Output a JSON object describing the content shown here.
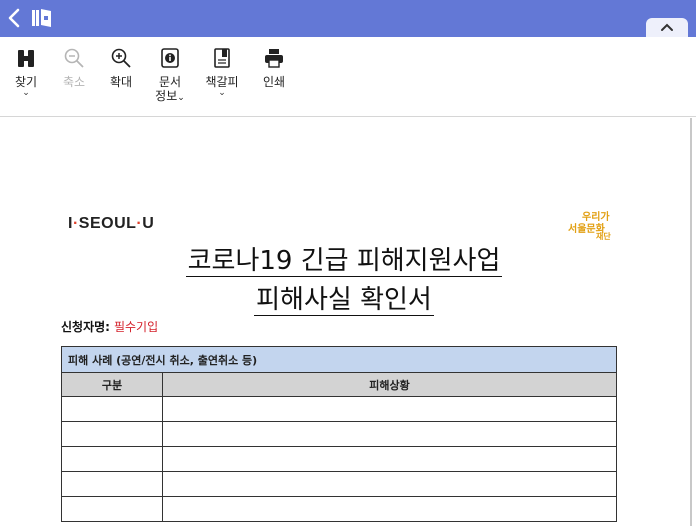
{
  "toolbar": {
    "items": [
      {
        "label": "찾기",
        "icon": "binoculars-icon",
        "has_dropdown": true,
        "enabled": true
      },
      {
        "label": "축소",
        "icon": "zoom-out-icon",
        "has_dropdown": false,
        "enabled": false
      },
      {
        "label": "확대",
        "icon": "zoom-in-icon",
        "has_dropdown": false,
        "enabled": true
      },
      {
        "label": "문서",
        "label2": "정보",
        "icon": "info-icon",
        "has_dropdown": true,
        "enabled": true
      },
      {
        "label": "책갈피",
        "icon": "bookmark-icon",
        "has_dropdown": true,
        "enabled": true
      },
      {
        "label": "인쇄",
        "icon": "printer-icon",
        "has_dropdown": false,
        "enabled": true
      }
    ],
    "chevron": "⌄"
  },
  "colors": {
    "topbar": "#6378d6",
    "section_header": "#c3d5ee",
    "column_header": "#d3d3d3",
    "required_text": "#d4202a",
    "seal": "#e2a013"
  },
  "document": {
    "logo": {
      "part1": "I",
      "dot": "·",
      "part2": "SEOUL",
      "dot2": "·",
      "part3": "U"
    },
    "seal_text": "우리가 서울문화재단",
    "title_line1": "코로나19 긴급 피해지원사업",
    "title_line2": "피해사실 확인서",
    "applicant_label": "신청자명:",
    "applicant_value": "필수기입",
    "table": {
      "section_title": "피해 사례 (공연/전시 취소, 출연취소 등)",
      "columns": [
        "구분",
        "피해상황"
      ],
      "rows": [
        [
          "",
          ""
        ],
        [
          "",
          ""
        ],
        [
          "",
          ""
        ],
        [
          "",
          ""
        ],
        [
          "",
          ""
        ]
      ]
    }
  }
}
